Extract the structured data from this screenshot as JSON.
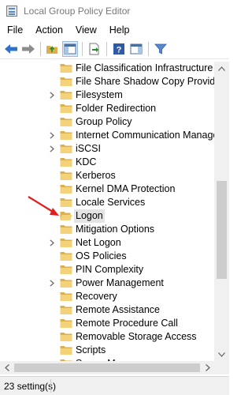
{
  "window": {
    "title": "Local Group Policy Editor"
  },
  "menu": [
    {
      "label": "File"
    },
    {
      "label": "Action"
    },
    {
      "label": "View"
    },
    {
      "label": "Help"
    }
  ],
  "toolbar": {
    "buttons": [
      {
        "icon": "back-arrow-icon"
      },
      {
        "icon": "forward-arrow-icon"
      },
      {
        "icon": "up-folder-icon"
      },
      {
        "icon": "show-hide-tree-icon"
      },
      {
        "icon": "export-list-icon"
      },
      {
        "icon": "help-icon"
      },
      {
        "icon": "properties-pane-icon"
      },
      {
        "icon": "filter-icon"
      }
    ]
  },
  "tree": {
    "items": [
      {
        "label": "File Classification Infrastructure",
        "expandable": false
      },
      {
        "label": "File Share Shadow Copy Provider",
        "expandable": false
      },
      {
        "label": "Filesystem",
        "expandable": true
      },
      {
        "label": "Folder Redirection",
        "expandable": false
      },
      {
        "label": "Group Policy",
        "expandable": false
      },
      {
        "label": "Internet Communication Managen",
        "expandable": true
      },
      {
        "label": "iSCSI",
        "expandable": true
      },
      {
        "label": "KDC",
        "expandable": false
      },
      {
        "label": "Kerberos",
        "expandable": false
      },
      {
        "label": "Kernel DMA Protection",
        "expandable": false
      },
      {
        "label": "Locale Services",
        "expandable": false
      },
      {
        "label": "Logon",
        "expandable": false,
        "selected": true
      },
      {
        "label": "Mitigation Options",
        "expandable": false
      },
      {
        "label": "Net Logon",
        "expandable": true
      },
      {
        "label": "OS Policies",
        "expandable": false
      },
      {
        "label": "PIN Complexity",
        "expandable": false
      },
      {
        "label": "Power Management",
        "expandable": true
      },
      {
        "label": "Recovery",
        "expandable": false
      },
      {
        "label": "Remote Assistance",
        "expandable": false
      },
      {
        "label": "Remote Procedure Call",
        "expandable": false
      },
      {
        "label": "Removable Storage Access",
        "expandable": false
      },
      {
        "label": "Scripts",
        "expandable": false
      },
      {
        "label": "Server Manager",
        "expandable": false
      }
    ]
  },
  "status": {
    "text": "23 setting(s)"
  },
  "colors": {
    "folder": "#dcb04c",
    "folder_light": "#f3d27a",
    "accent_blue": "#2e72c8",
    "arrow_red": "#e11d1d",
    "selected_bg": "#e4e4e4"
  }
}
